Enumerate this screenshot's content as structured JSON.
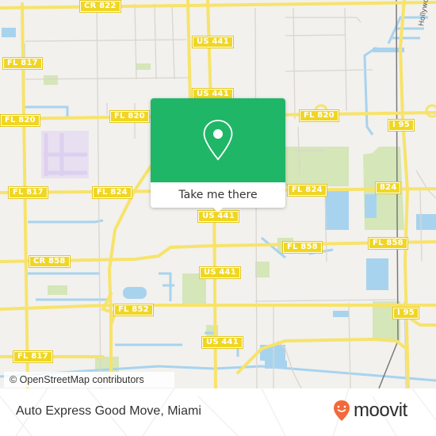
{
  "map": {
    "colors": {
      "land": "#f2f1ed",
      "road_major": "#f7e36b",
      "road_minor": "#d9d6cf",
      "water": "#a8d3ef",
      "park": "#d5e6b8",
      "shield_fill": "#f0d623",
      "rail": "#7a7a7a",
      "airport": "#e8dff1"
    },
    "road_shields": [
      {
        "id": "cr822",
        "label": "CR 822"
      },
      {
        "id": "us441-a",
        "label": "US 441"
      },
      {
        "id": "fl817-a",
        "label": "FL 817"
      },
      {
        "id": "us441-b",
        "label": "US 441"
      },
      {
        "id": "fl820-a",
        "label": "FL 820"
      },
      {
        "id": "fl820-b",
        "label": "FL 820"
      },
      {
        "id": "fl820-c",
        "label": "FL 820"
      },
      {
        "id": "i95-a",
        "label": "I 95"
      },
      {
        "id": "fl817-b",
        "label": "FL 817"
      },
      {
        "id": "fl824-a",
        "label": "FL 824"
      },
      {
        "id": "fl824-b",
        "label": "FL 824"
      },
      {
        "id": "824",
        "label": "824"
      },
      {
        "id": "us441-c",
        "label": "US 441"
      },
      {
        "id": "cr858",
        "label": "CR 858"
      },
      {
        "id": "fl858-a",
        "label": "FL 858"
      },
      {
        "id": "fl858-b",
        "label": "FL 858"
      },
      {
        "id": "us441-d",
        "label": "US 441"
      },
      {
        "id": "fl852",
        "label": "FL 852"
      },
      {
        "id": "i95-b",
        "label": "I 95"
      },
      {
        "id": "us441-e",
        "label": "US 441"
      },
      {
        "id": "fl817-c",
        "label": "FL 817"
      }
    ],
    "street_labels": [
      {
        "id": "hollywood",
        "label": "Hollywood"
      }
    ],
    "attribution": "© OpenStreetMap contributors"
  },
  "popup": {
    "icon": "location-pin-icon",
    "button_label": "Take me there",
    "color": "#1fb668"
  },
  "footer": {
    "place_name": "Auto Express Good Move, Miami",
    "brand": "moovit",
    "brand_color": "#f26a3b"
  }
}
